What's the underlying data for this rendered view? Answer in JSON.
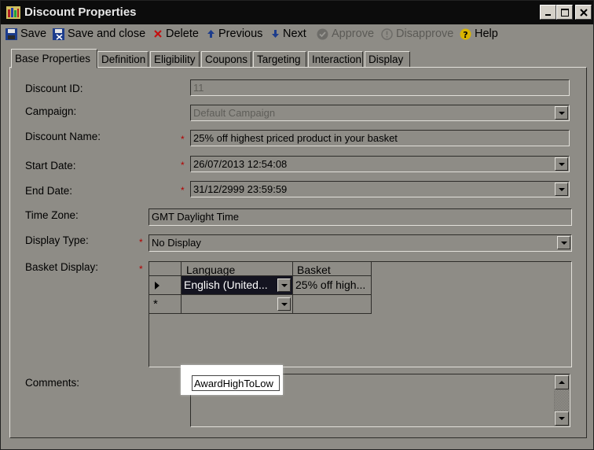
{
  "window": {
    "title": "Discount Properties"
  },
  "toolbar": {
    "save": "Save",
    "save_close": "Save and close",
    "delete": "Delete",
    "previous": "Previous",
    "next": "Next",
    "approve": "Approve",
    "disapprove": "Disapprove",
    "help": "Help"
  },
  "tabs": [
    "Base Properties",
    "Definition",
    "Eligibility",
    "Coupons",
    "Targeting",
    "Interaction",
    "Display"
  ],
  "form": {
    "discount_id_label": "Discount ID:",
    "discount_id_value": "11",
    "campaign_label": "Campaign:",
    "campaign_value": "Default Campaign",
    "name_label": "Discount Name:",
    "name_value": "25% off highest priced product in your basket",
    "start_label": "Start Date:",
    "start_value": "26/07/2013 12:54:08",
    "end_label": "End Date:",
    "end_value": "31/12/2999 23:59:59",
    "tz_label": "Time Zone:",
    "tz_value": "GMT Daylight Time",
    "display_type_label": "Display Type:",
    "display_type_value": "No Display",
    "basket_label": "Basket Display:",
    "comments_label": "Comments:",
    "comments_value": "AwardHighToLow",
    "required_mark": "*"
  },
  "basket_grid": {
    "columns": [
      "Language",
      "Basket"
    ],
    "rows": [
      {
        "language": "English (United...",
        "basket": "25% off high..."
      }
    ],
    "new_row_marker": "*"
  },
  "colors": {
    "background": "#8e8c86",
    "titlebar": "#0c0c0c",
    "required": "#b30000",
    "selection": "#141420"
  }
}
